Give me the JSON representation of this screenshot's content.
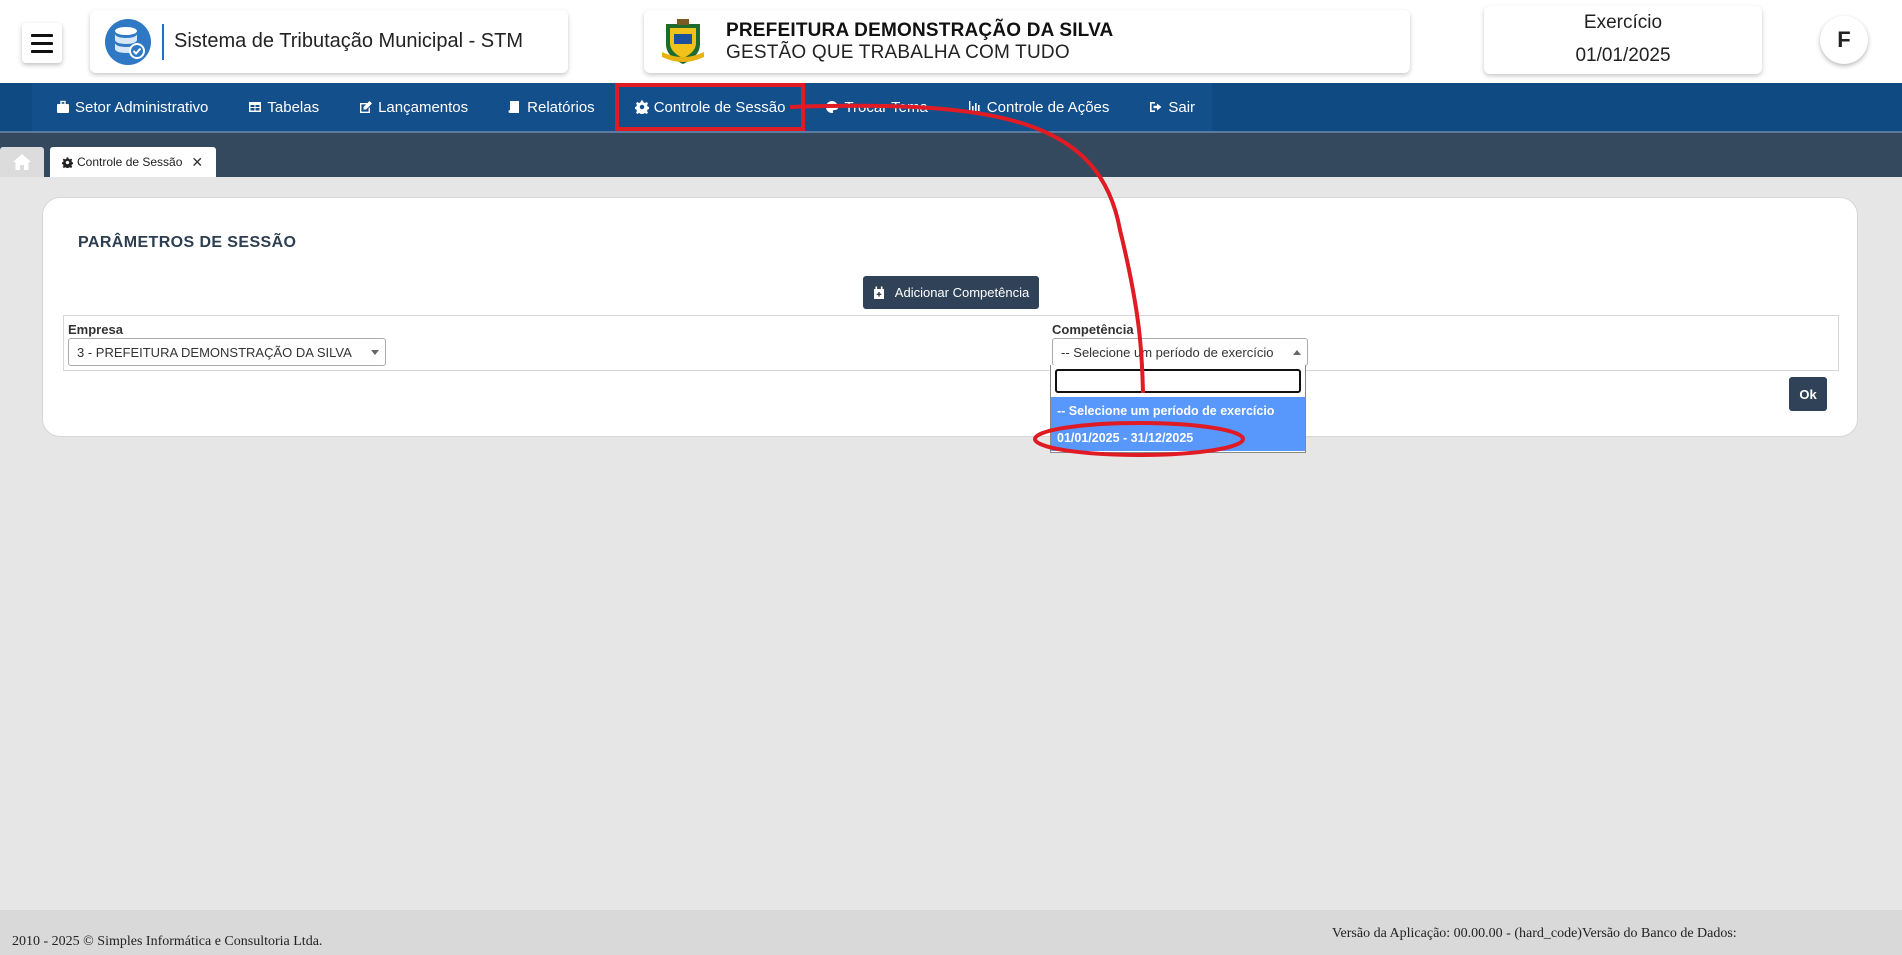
{
  "header": {
    "app_title": "Sistema de Tributação Municipal - STM",
    "pref_title": "PREFEITURA DEMONSTRAÇÃO DA SILVA",
    "pref_subtitle": "GESTÃO QUE TRABALHA COM TUDO",
    "exercicio_label": "Exercício",
    "exercicio_value": "01/01/2025",
    "avatar_letter": "F"
  },
  "nav": {
    "items": [
      {
        "label": "Setor Administrativo",
        "icon": "briefcase-icon"
      },
      {
        "label": "Tabelas",
        "icon": "table-icon"
      },
      {
        "label": "Lançamentos",
        "icon": "edit-icon"
      },
      {
        "label": "Relatórios",
        "icon": "book-icon"
      },
      {
        "label": "Controle de Sessão",
        "icon": "gear-icon"
      },
      {
        "label": "Trocar Tema",
        "icon": "palette-icon"
      },
      {
        "label": "Controle de Ações",
        "icon": "chart-icon"
      },
      {
        "label": "Sair",
        "icon": "sign-out-icon"
      }
    ]
  },
  "tabs": {
    "active_label": "Controle de Sessão"
  },
  "panel": {
    "title": "PARÂMETROS DE SESSÃO",
    "add_button": "Adicionar Competência",
    "empresa_label": "Empresa",
    "empresa_value": "3 - PREFEITURA DEMONSTRAÇÃO DA SILVA",
    "competencia_label": "Competência",
    "competencia_placeholder": "-- Selecione um período de exercício",
    "ok_button": "Ok"
  },
  "dropdown": {
    "search_value": "",
    "options": [
      "-- Selecione um período de exercício",
      "01/01/2025 - 31/12/2025"
    ]
  },
  "colors": {
    "nav_bg": "#134f8a",
    "dark_button": "#2f4257",
    "tab_bar": "#34495e",
    "option_highlight": "#5897fb",
    "annotation_red": "#e01b24"
  },
  "footer": {
    "copyright": "2010 - 2025 © Simples Informática e Consultoria Ltda.",
    "version": "Versão da Aplicação: 00.00.00 - (hard_code)Versão do Banco de Dados:"
  }
}
